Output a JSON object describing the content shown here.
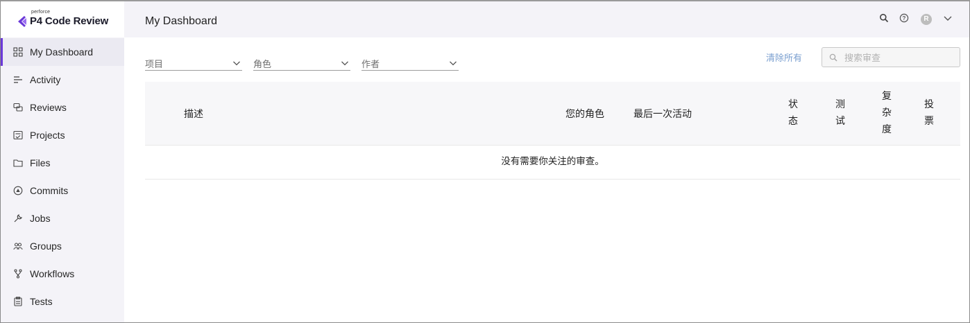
{
  "brand": {
    "super": "perforce",
    "name": "P4 Code Review",
    "accent": "#6b39d8"
  },
  "header": {
    "title": "My Dashboard",
    "avatar_initial": "R",
    "icons": [
      "search-icon",
      "help-icon",
      "avatar",
      "chevron-down-icon"
    ]
  },
  "sidebar": {
    "items": [
      {
        "label": "My Dashboard",
        "icon": "dashboard-icon",
        "active": true
      },
      {
        "label": "Activity",
        "icon": "activity-icon"
      },
      {
        "label": "Reviews",
        "icon": "reviews-icon"
      },
      {
        "label": "Projects",
        "icon": "projects-icon"
      },
      {
        "label": "Files",
        "icon": "folder-icon"
      },
      {
        "label": "Commits",
        "icon": "commits-icon"
      },
      {
        "label": "Jobs",
        "icon": "wrench-icon"
      },
      {
        "label": "Groups",
        "icon": "groups-icon"
      },
      {
        "label": "Workflows",
        "icon": "workflows-icon"
      },
      {
        "label": "Tests",
        "icon": "clipboard-icon"
      }
    ]
  },
  "filters": {
    "project": "项目",
    "role": "角色",
    "author": "作者",
    "clear_all": "清除所有",
    "search_placeholder": "搜索审查"
  },
  "table": {
    "columns": {
      "description": "描述",
      "your_role": "您的角色",
      "last_activity": "最后一次活动",
      "status": [
        "状",
        "态"
      ],
      "tests": [
        "测",
        "试"
      ],
      "complexity": [
        "复",
        "杂",
        "度"
      ],
      "votes": [
        "投",
        "票"
      ]
    },
    "empty_message": "没有需要你关注的审查。"
  }
}
